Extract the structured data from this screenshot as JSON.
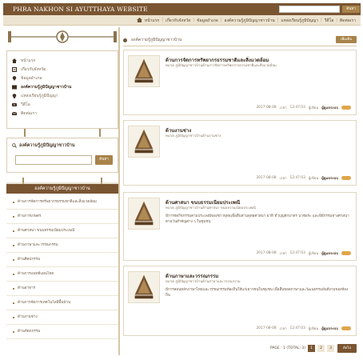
{
  "header": {
    "site_title": "PHRA NAKHON SI AYUTTHAYA WEBSITE",
    "search_button": "ค้นหา"
  },
  "menu": [
    "หน้าแรก",
    "เกี่ยวกับจังหวัด",
    "ข้อมูลอำเภอ",
    "องค์ความรู้ภูมิปัญญาชาวบ้าน",
    "แหล่งเรียนรู้ภูมิปัญญา",
    "วีดีโอ",
    "ติดต่อเรา"
  ],
  "sidebar": {
    "nav": [
      {
        "label": "หน้าแรก",
        "icon": "home-icon"
      },
      {
        "label": "เกี่ยวกับจังหวัด",
        "icon": "document-icon"
      },
      {
        "label": "ข้อมูลอำเภอ",
        "icon": "pin-icon"
      },
      {
        "label": "องค์ความรู้ภูมิปัญญาชาวบ้าน",
        "icon": "book-icon",
        "active": true
      },
      {
        "label": "แหล่งเรียนรู้ภูมิปัญญา",
        "icon": "lightbulb-icon"
      },
      {
        "label": "วีดีโอ",
        "icon": "video-icon"
      },
      {
        "label": "ติดต่อเรา",
        "icon": "mail-icon"
      }
    ],
    "search_title": "องค์ความรู้ภูมิปัญญาชาวบ้าน",
    "search_button": "ค้นหา",
    "category_header": "องค์ความรู้ภูมิปัญญาชาวบ้าน",
    "categories": [
      "ด้านการจัดการทรัพยากรธรรมชาติและสิ่งแวดล้อม",
      "ด้านการเกษตร",
      "ด้านศาสนา ขนบธรรมเนียมประเพณี",
      "ด้านภาษาและวรรณกรรม",
      "ด้านศิลปกรรม",
      "ด้านการแพทย์แผนไทย",
      "ด้านอาหาร",
      "ด้านการจัดการเทคโนโลยีพื้นบ้าน",
      "ด้านงานช่าง",
      "ด้านหัตถกรรม"
    ]
  },
  "breadcrumb": {
    "text": "องค์ความรู้ภูมิปัญญาชาวบ้าน",
    "button": "เพิ่มเติม"
  },
  "cards": [
    {
      "title": "ด้านการจัดการทรัพยากรธรรมชาติและสิ่งแวดล้อม",
      "meta": "หมวด ภูมิปัญญาชาวบ้านด้านการจัดการทรัพยากรธรรมชาติและสิ่งแวดล้อม",
      "desc": "",
      "date": "2017-08-08",
      "time": "12:47:03",
      "author": "ผู้ดูแลระบบ",
      "author_label": "ผู้เขียน",
      "time_label": "เวลา"
    },
    {
      "title": "ด้านงานช่าง",
      "meta": "หมวด ภูมิปัญญาชาวบ้านด้านงานช่าง",
      "desc": "",
      "date": "2017-08-08",
      "time": "12:47:03",
      "author": "ผู้ดูแลระบบ",
      "author_label": "ผู้เขียน",
      "time_label": "เวลา"
    },
    {
      "title": "ด้านศาสนา ขนบธรรมเนียมประเพณี",
      "meta": "หมวด ภูมิปัญญาชาวบ้านด้านศาสนา ขนบธรรมเนียมประเพณี",
      "desc": "มีการจัดกิจกรรมตามประเพณีของชาวพุทธเพื่อสืบสานพุทธศาสนา อาทิ ทำบุญตักบาตร บวชพระ และพิธีกรรมทางศาสนาตามวันสำคัญต่าง ๆ ในชุมชน",
      "date": "2017-08-08",
      "time": "12:47:03",
      "author": "ผู้ดูแลระบบ",
      "author_label": "ผู้เขียน",
      "time_label": "เวลา"
    },
    {
      "title": "ด้านภาษาและวรรณกรรม",
      "meta": "หมวด ภูมิปัญญาชาวบ้านด้านภาษาและวรรณกรรม",
      "desc": "มีการสอนหลักภาษาไทยและวรรณกรรมท้องถิ่นให้แก่เยาวชนในชุมชน เพื่อสืบทอดภาษาและวัฒนธรรมอันดีงามของท้องถิ่น",
      "date": "2017-08-08",
      "time": "12:47:03",
      "author": "ผู้ดูแลระบบ",
      "author_label": "ผู้เขียน",
      "time_label": "เวลา"
    }
  ],
  "pager": {
    "label": "PAGE : 1 (TOTAL: 3)",
    "pages": [
      "1",
      "2",
      "3"
    ],
    "current": "1",
    "next_button": "ถัดไป"
  },
  "colors": {
    "brand": "#7a5532",
    "accent": "#a8834a",
    "menubar": "#ede3d1",
    "readmore": "#e0a64a"
  }
}
